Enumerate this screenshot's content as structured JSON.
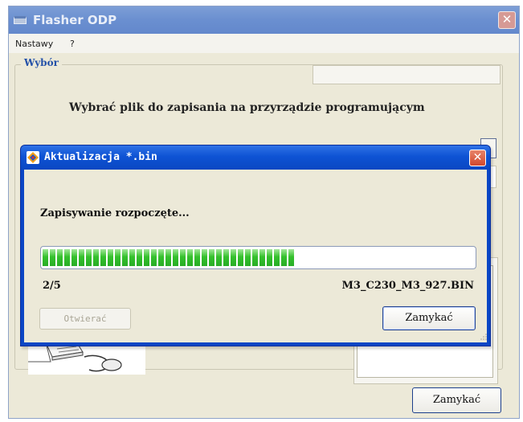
{
  "main_window": {
    "title": "Flasher ODP",
    "close_glyph": "✕",
    "menu": [
      {
        "label": "Nastawy"
      },
      {
        "label": "?"
      }
    ],
    "group_label": "Wybór",
    "instruction": "Wybrać plik do zapisania na przyrządzie programującym",
    "close_button": "Zamykać"
  },
  "dialog": {
    "title": "Aktualizacja *.bin",
    "close_glyph": "✕",
    "status": "Zapisywanie rozpoczęte...",
    "progress": {
      "filled_fraction": 0.6
    },
    "count": "2/5",
    "file_name": "M3_C230_M3_927.BIN",
    "open_button": "Otwierać",
    "close_button": "Zamykać"
  },
  "colors": {
    "dialog_title_blue": "#0e53d4",
    "progress_green": "#35c12d",
    "window_face": "#ece9d8"
  }
}
